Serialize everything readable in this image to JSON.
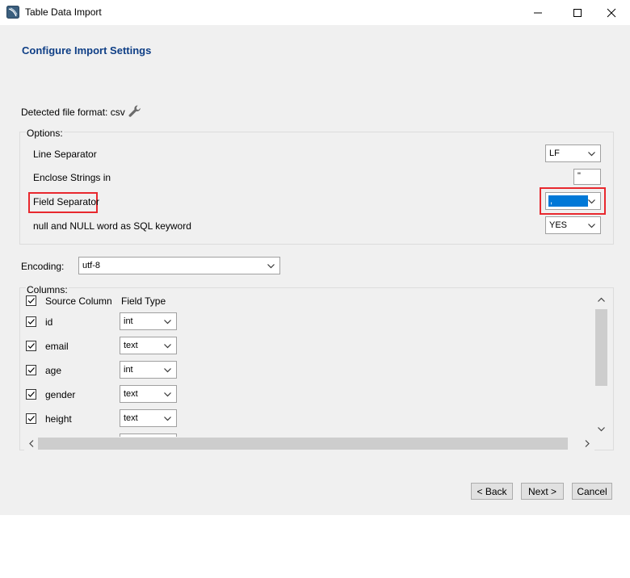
{
  "window": {
    "title": "Table Data Import"
  },
  "page": {
    "heading": "Configure Import Settings"
  },
  "detected": {
    "label": "Detected file format: csv",
    "icon": "wrench-icon"
  },
  "options": {
    "legend": "Options:",
    "line_separator_label": "Line Separator",
    "line_separator_value": "LF",
    "enclose_label": "Enclose Strings in",
    "enclose_value": "\"",
    "field_separator_label": "Field Separator",
    "field_separator_value": ",",
    "null_label": "null and NULL word as SQL keyword",
    "null_value": "YES"
  },
  "encoding": {
    "label": "Encoding:",
    "value": "utf-8"
  },
  "columns": {
    "legend": "Columns:",
    "header_source": "Source Column",
    "header_type": "Field Type",
    "rows": [
      {
        "name": "id",
        "type": "int",
        "checked": true
      },
      {
        "name": "email",
        "type": "text",
        "checked": true
      },
      {
        "name": "age",
        "type": "int",
        "checked": true
      },
      {
        "name": "gender",
        "type": "text",
        "checked": true
      },
      {
        "name": "height",
        "type": "text",
        "checked": true
      }
    ]
  },
  "buttons": {
    "back": "< Back",
    "next": "Next >",
    "cancel": "Cancel"
  },
  "colors": {
    "highlight": "#e8282e",
    "heading": "#0f3f86",
    "selection": "#0078d7"
  }
}
